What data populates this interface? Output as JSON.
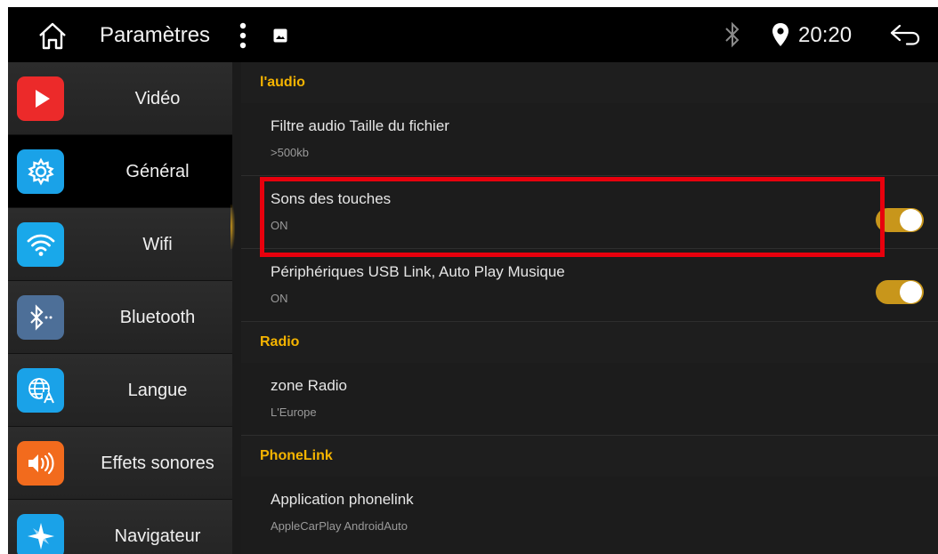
{
  "statusbar": {
    "title": "Paramètres",
    "time": "20:20",
    "icons": [
      "home-icon",
      "more-vert-icon",
      "image-icon",
      "bluetooth-icon",
      "location-pin-icon",
      "back-arrow-icon"
    ]
  },
  "sidebar": {
    "items": [
      {
        "label": "Vidéo",
        "icon": "play-icon",
        "color": "#ec2a2a",
        "active": false
      },
      {
        "label": "Général",
        "icon": "gear-icon",
        "color": "#1aa2e8",
        "active": true
      },
      {
        "label": "Wifi",
        "icon": "wifi-icon",
        "color": "#19a8ea",
        "active": false
      },
      {
        "label": "Bluetooth",
        "icon": "bluetooth-icon",
        "color": "#4d6f98",
        "active": false
      },
      {
        "label": "Langue",
        "icon": "globe-language-icon",
        "color": "#1aa2e8",
        "active": false
      },
      {
        "label": "Effets sonores",
        "icon": "speaker-icon",
        "color": "#f26b1d",
        "active": false
      },
      {
        "label": "Navigateur",
        "icon": "compass-icon",
        "color": "#1aa2e8",
        "active": false
      }
    ]
  },
  "sections": {
    "audio": {
      "header": "l'audio",
      "rows": [
        {
          "title": "Filtre audio Taille du fichier",
          "value": ">500kb"
        },
        {
          "title": "Sons des touches",
          "value": "ON",
          "toggle": true
        },
        {
          "title": "Périphériques USB Link, Auto Play Musique",
          "value": "ON",
          "toggle": true
        }
      ]
    },
    "radio": {
      "header": "Radio",
      "rows": [
        {
          "title": "zone Radio",
          "value": "L'Europe"
        }
      ]
    },
    "phonelink": {
      "header": "PhoneLink",
      "rows": [
        {
          "title": "Application phonelink",
          "value": "AppleCarPlay AndroidAuto"
        }
      ]
    }
  },
  "colors": {
    "accent": "#f5b400",
    "toggle_on": "#c8961b",
    "highlight": "#e8000d"
  }
}
